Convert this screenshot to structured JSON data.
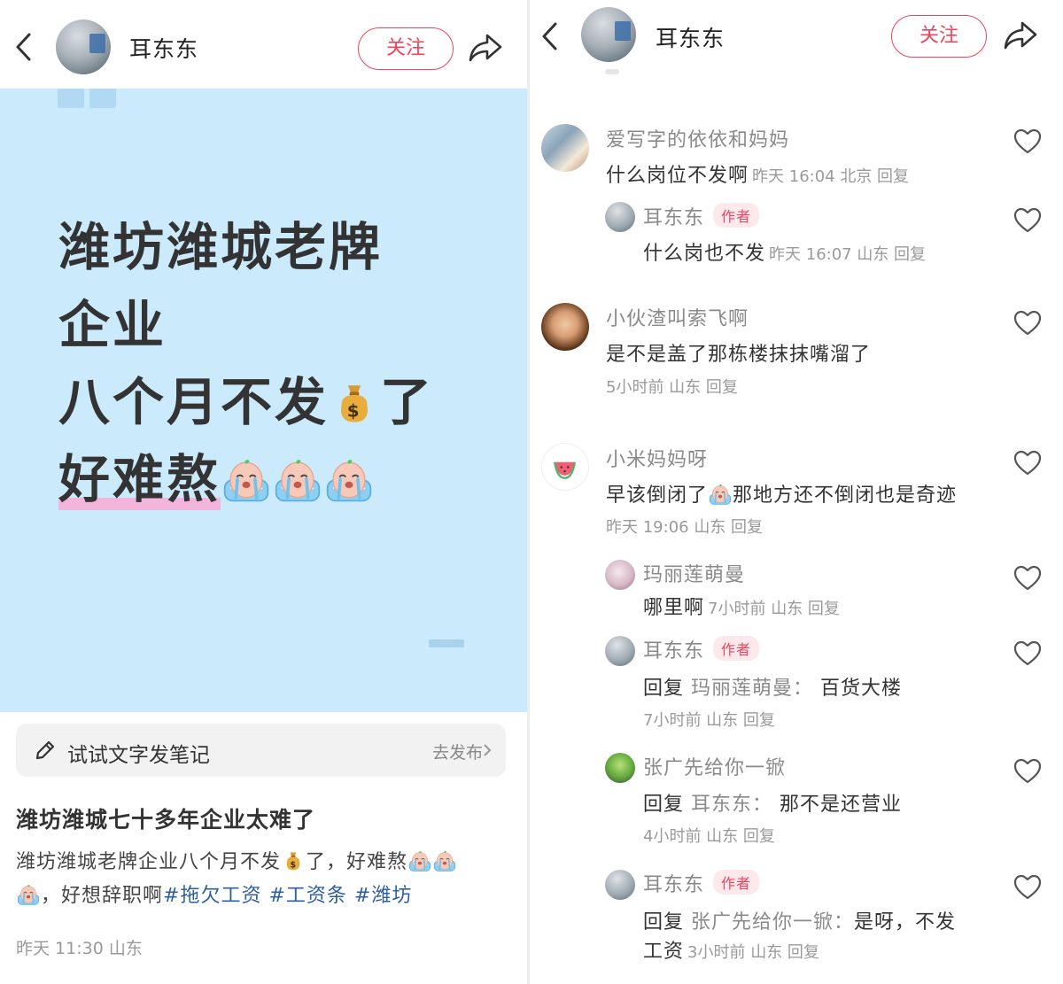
{
  "left": {
    "header": {
      "username": "耳东东",
      "follow_label": "关注"
    },
    "cover": {
      "line1": "潍坊潍城老牌",
      "line2": "企业",
      "line3_text": "八个月不发",
      "line3_suffix": "了",
      "line4": "好难熬"
    },
    "try_bar": {
      "label": "试试文字发笔记",
      "action": "去发布"
    },
    "post": {
      "title": "潍坊潍城七十多年企业太难了",
      "body_part1": "潍坊潍城老牌企业八个月不发",
      "body_part2": "了，好难熬",
      "body_part3": "，好想辞职啊",
      "tags": [
        "#拖欠工资",
        "#工资条",
        "#潍坊"
      ],
      "meta": "昨天 11:30 山东"
    }
  },
  "right": {
    "header": {
      "username": "耳东东",
      "follow_label": "关注"
    },
    "author_badge": "作者",
    "reply_word": "回复",
    "comments": [
      {
        "name": "爱写字的依依和妈妈",
        "text": "什么岗位不发啊",
        "meta": "昨天 16:04 北京 回复"
      },
      {
        "name": "耳东东",
        "text": "什么岗也不发",
        "meta": "昨天 16:07 山东 回复"
      },
      {
        "name": "小伙渣叫索飞啊",
        "text": "是不是盖了那栋楼抹抹嘴溜了",
        "meta": "5小时前 山东 回复"
      },
      {
        "name": "小米妈妈呀",
        "text_a": "早该倒闭了",
        "text_b": "那地方还不倒闭也是奇迹",
        "meta": "昨天 19:06 山东 回复"
      },
      {
        "name": "玛丽莲萌曼",
        "text": "哪里啊",
        "meta": "7小时前 山东 回复"
      },
      {
        "name": "耳东东",
        "reply_target": "玛丽莲萌曼：",
        "text": "百货大楼",
        "meta": "7小时前 山东 回复"
      },
      {
        "name": "张广先给你一锨",
        "reply_target": "耳东东：",
        "text": "那不是还营业",
        "meta": "4小时前 山东 回复"
      },
      {
        "name": "耳东东",
        "reply_target": "张广先给你一锨：",
        "text": "是呀，不发",
        "text2": "工资",
        "meta": "3小时前 山东 回复"
      }
    ]
  }
}
